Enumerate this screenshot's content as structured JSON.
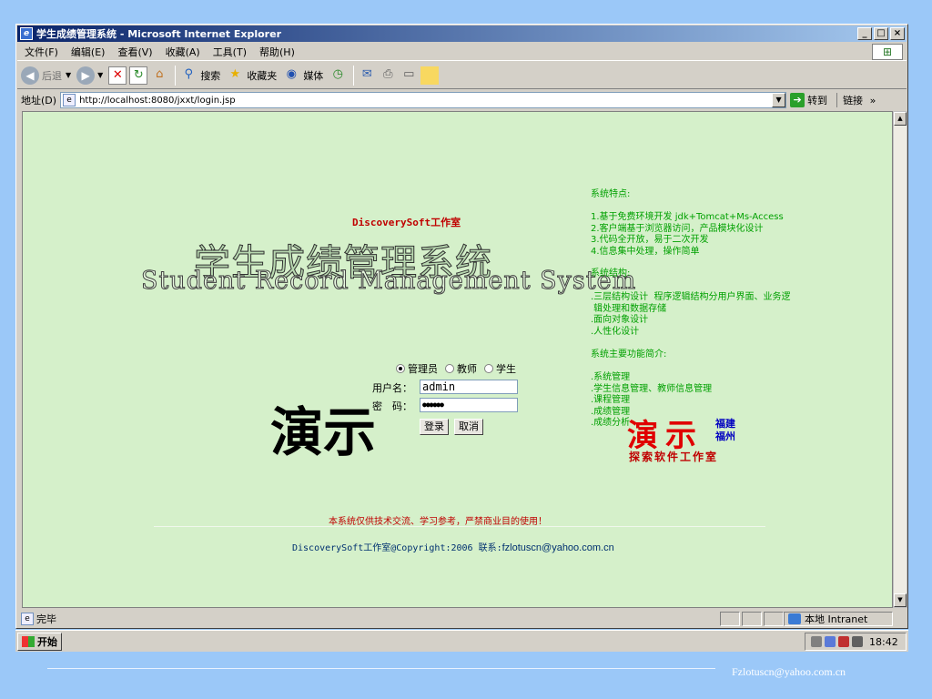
{
  "window": {
    "title": "学生成绩管理系统 - Microsoft Internet Explorer"
  },
  "menu": [
    "文件(F)",
    "编辑(E)",
    "查看(V)",
    "收藏(A)",
    "工具(T)",
    "帮助(H)"
  ],
  "toolbar": {
    "back": "后退",
    "search": "搜索",
    "favorites": "收藏夹",
    "media": "媒体"
  },
  "address": {
    "label": "地址(D)",
    "url": "http://localhost:8080/jxxt/login.jsp",
    "go": "转到",
    "links": "链接"
  },
  "page": {
    "studio": "DiscoverySoft工作室",
    "title_cn": "学生成绩管理系统",
    "title_en": "Student Record Management System",
    "demo": "演示",
    "roles": [
      "管理员",
      "教师",
      "学生"
    ],
    "selected_role": "管理员",
    "username_label": "用户名：",
    "password_label": "密　码：",
    "username_value": "admin",
    "password_value": "●●●●●●",
    "login_button": "登录",
    "cancel_button": "取消",
    "features_title": "系统特点:",
    "features": "1.基于免费环境开发 jdk+Tomcat+Ms-Access\n2.客户端基于浏览器访问，产品模块化设计\n3.代码全开放，易于二次开发\n4.信息集中处理，操作简单",
    "structure_title": "系统结构:",
    "structure": ".三层结构设计  程序逻辑结构分用户界面、业务逻\n 辑处理和数据存储\n.面向对象设计\n.人性化设计",
    "functions_title": "系统主要功能简介:",
    "functions": ".系统管理\n.学生信息管理、教师信息管理\n.课程管理\n.成绩管理\n.成绩分析",
    "demo2": "演示",
    "fujian": "福建",
    "fuzhou": "福州",
    "tansuo": "探索软件工作室",
    "notice": "本系统仅供技术交流、学习参考，严禁商业目的使用！",
    "copyright": "DiscoverySoft工作室@Copyright:2006 联系:",
    "email": "fzlotuscn@yahoo.com.cn"
  },
  "status": {
    "text": "完毕",
    "zone": "本地 Intranet"
  },
  "taskbar": {
    "start": "开始",
    "clock": "18:42"
  },
  "slide_footer": "Fzlotuscn@yahoo.com.cn"
}
